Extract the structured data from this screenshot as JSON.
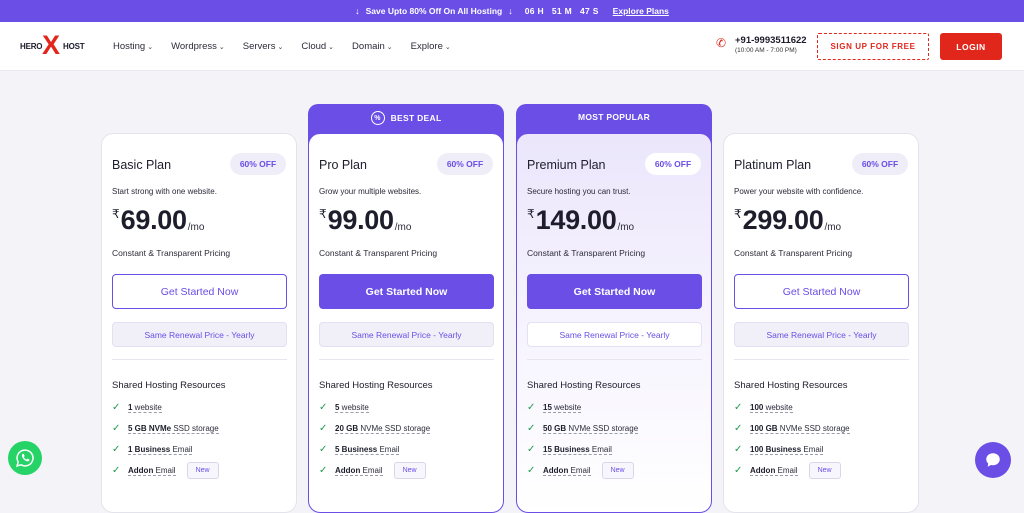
{
  "promo": {
    "text": "Save Upto 80% Off On All Hosting",
    "timer": "06 H   51 M   47 S",
    "link": "Explore Plans"
  },
  "nav": {
    "logo": {
      "left": "HERO",
      "x": "X",
      "right": "HOST"
    },
    "menu": [
      "Hosting",
      "Wordpress",
      "Servers",
      "Cloud",
      "Domain",
      "Explore"
    ],
    "phone": "+91-9993511622",
    "hours": "(10:00 AM - 7:00 PM)",
    "signup": "SIGN UP FOR FREE",
    "login": "LOGIN"
  },
  "ribbons": {
    "best_deal": "BEST DEAL",
    "most_popular": "MOST POPULAR"
  },
  "plans": [
    {
      "name": "Basic Plan",
      "off": "60% OFF",
      "tagline": "Start strong with one website.",
      "currency": "₹",
      "price": "69.00",
      "period": "/mo",
      "pricing_note": "Constant & Transparent Pricing",
      "cta": "Get Started Now",
      "renewal": "Same Renewal Price - Yearly",
      "resources_title": "Shared Hosting Resources",
      "features": [
        {
          "bold": "1",
          "rest": " website"
        },
        {
          "bold": "5 GB NVMe",
          "rest": " SSD storage"
        },
        {
          "bold": "1 Business",
          "rest": " Email"
        },
        {
          "bold": "Addon",
          "rest": " Email",
          "badge": "New"
        }
      ]
    },
    {
      "name": "Pro Plan",
      "off": "60% OFF",
      "tagline": "Grow your multiple websites.",
      "currency": "₹",
      "price": "99.00",
      "period": "/mo",
      "pricing_note": "Constant & Transparent Pricing",
      "cta": "Get Started Now",
      "renewal": "Same Renewal Price - Yearly",
      "resources_title": "Shared Hosting Resources",
      "features": [
        {
          "bold": "5",
          "rest": " website"
        },
        {
          "bold": "20 GB",
          "rest": " NVMe SSD storage"
        },
        {
          "bold": "5 Business",
          "rest": " Email"
        },
        {
          "bold": "Addon",
          "rest": " Email",
          "badge": "New"
        }
      ]
    },
    {
      "name": "Premium Plan",
      "off": "60% OFF",
      "tagline": "Secure hosting you can trust.",
      "currency": "₹",
      "price": "149.00",
      "period": "/mo",
      "pricing_note": "Constant & Transparent Pricing",
      "cta": "Get Started Now",
      "renewal": "Same Renewal Price - Yearly",
      "resources_title": "Shared Hosting Resources",
      "features": [
        {
          "bold": "15",
          "rest": " website"
        },
        {
          "bold": "50 GB",
          "rest": " NVMe SSD storage"
        },
        {
          "bold": "15 Business",
          "rest": " Email"
        },
        {
          "bold": "Addon",
          "rest": " Email",
          "badge": "New"
        }
      ]
    },
    {
      "name": "Platinum Plan",
      "off": "60% OFF",
      "tagline": "Power your website with confidence.",
      "currency": "₹",
      "price": "299.00",
      "period": "/mo",
      "pricing_note": "Constant & Transparent Pricing",
      "cta": "Get Started Now",
      "renewal": "Same Renewal Price - Yearly",
      "resources_title": "Shared Hosting Resources",
      "features": [
        {
          "bold": "100",
          "rest": " website"
        },
        {
          "bold": "100 GB",
          "rest": " NVMe SSD storage"
        },
        {
          "bold": "100 Business",
          "rest": " Email"
        },
        {
          "bold": "Addon",
          "rest": " Email",
          "badge": "New"
        }
      ]
    }
  ],
  "colors": {
    "accent": "#6a4ee6",
    "brand_red": "#e1261c",
    "check_green": "#1f9b4e",
    "whatsapp": "#25d366"
  },
  "icons": {
    "whatsapp": "whatsapp-icon",
    "chat": "chat-icon",
    "phone": "phone-icon",
    "deal": "percent-badge-icon"
  }
}
